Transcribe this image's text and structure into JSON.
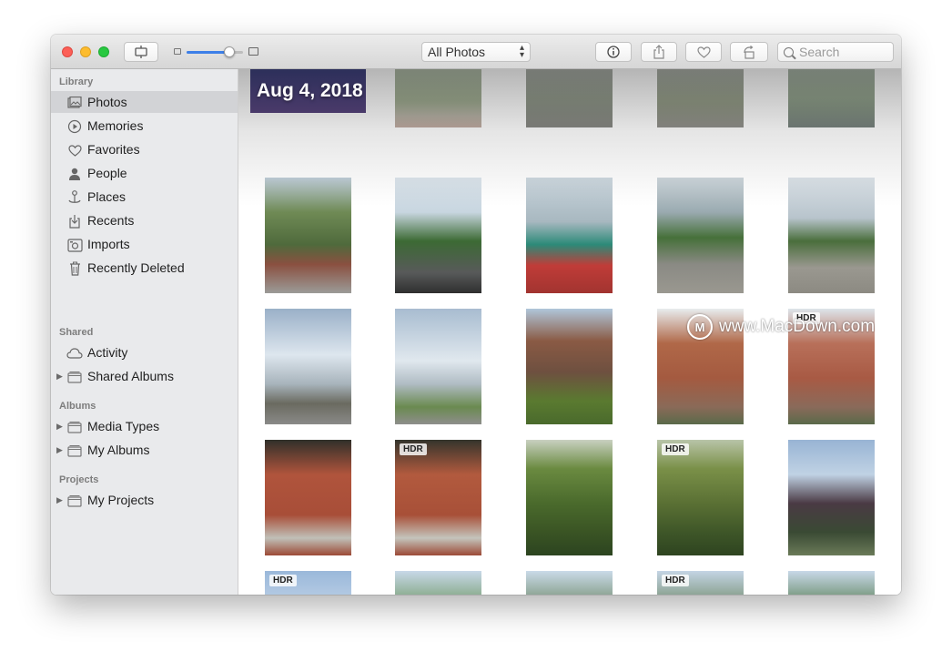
{
  "toolbar": {
    "view_select": "All Photos",
    "search_placeholder": "Search",
    "zoom_level": 0.75
  },
  "sidebar": {
    "library_header": "Library",
    "library_items": [
      {
        "label": "Photos",
        "icon": "photos-icon",
        "selected": true
      },
      {
        "label": "Memories",
        "icon": "memories-icon"
      },
      {
        "label": "Favorites",
        "icon": "heart-icon"
      },
      {
        "label": "People",
        "icon": "person-icon"
      },
      {
        "label": "Places",
        "icon": "pin-icon"
      },
      {
        "label": "Recents",
        "icon": "recents-icon"
      },
      {
        "label": "Imports",
        "icon": "camera-icon"
      },
      {
        "label": "Recently Deleted",
        "icon": "trash-icon"
      }
    ],
    "shared_header": "Shared",
    "shared_items": [
      {
        "label": "Activity",
        "icon": "cloud-icon"
      },
      {
        "label": "Shared Albums",
        "icon": "folder-icon"
      }
    ],
    "albums_header": "Albums",
    "albums_items": [
      {
        "label": "Media Types",
        "icon": "folder-icon"
      },
      {
        "label": "My Albums",
        "icon": "folder-icon"
      }
    ],
    "projects_header": "Projects",
    "projects_items": [
      {
        "label": "My Projects",
        "icon": "folder-icon"
      }
    ]
  },
  "grid": {
    "date_header": "Aug 4, 2018",
    "badge_text": "HDR"
  },
  "watermark": "www.MacDown.com"
}
